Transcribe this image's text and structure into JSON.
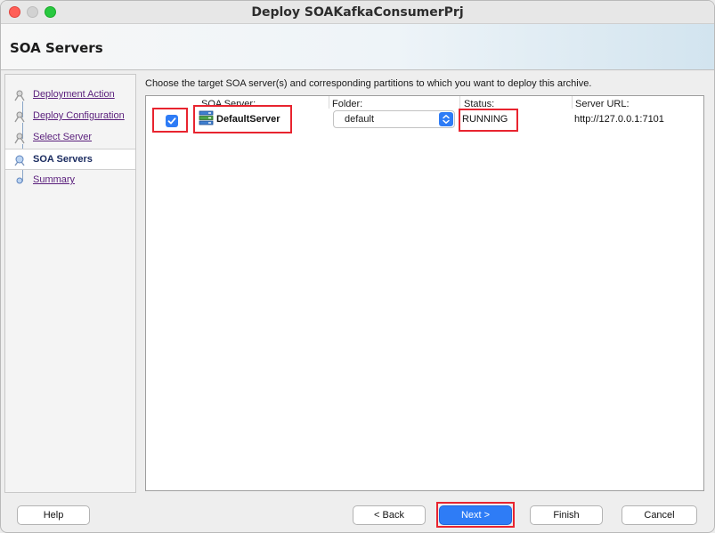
{
  "window": {
    "title": "Deploy SOAKafkaConsumerPrj"
  },
  "header": {
    "title": "SOA Servers"
  },
  "nav": {
    "items": [
      {
        "label": "Deployment Action",
        "current": false
      },
      {
        "label": "Deploy Configuration",
        "current": false
      },
      {
        "label": "Select Server",
        "current": false
      },
      {
        "label": "SOA Servers",
        "current": true
      },
      {
        "label": "Summary",
        "current": false
      }
    ]
  },
  "content": {
    "instruction": "Choose the target SOA server(s) and corresponding partitions to which you want to deploy this archive.",
    "columns": [
      "SOA Server:",
      "Folder:",
      "Status:",
      "Server URL:"
    ],
    "row": {
      "selected": true,
      "server": "DefaultServer",
      "folder": "default",
      "status": "RUNNING",
      "url": "http://127.0.0.1:7101"
    }
  },
  "buttons": {
    "help": "Help",
    "back": "< Back",
    "next": "Next >",
    "finish": "Finish",
    "cancel": "Cancel"
  },
  "colors": {
    "accent": "#2e7cf6",
    "highlight": "#e8242f",
    "link": "#5a1f7c"
  },
  "icons": {
    "nav": "train-stop-icon",
    "server": "server-icon",
    "select": "chevron-updown-icon",
    "checkbox": "checkmark-icon"
  }
}
